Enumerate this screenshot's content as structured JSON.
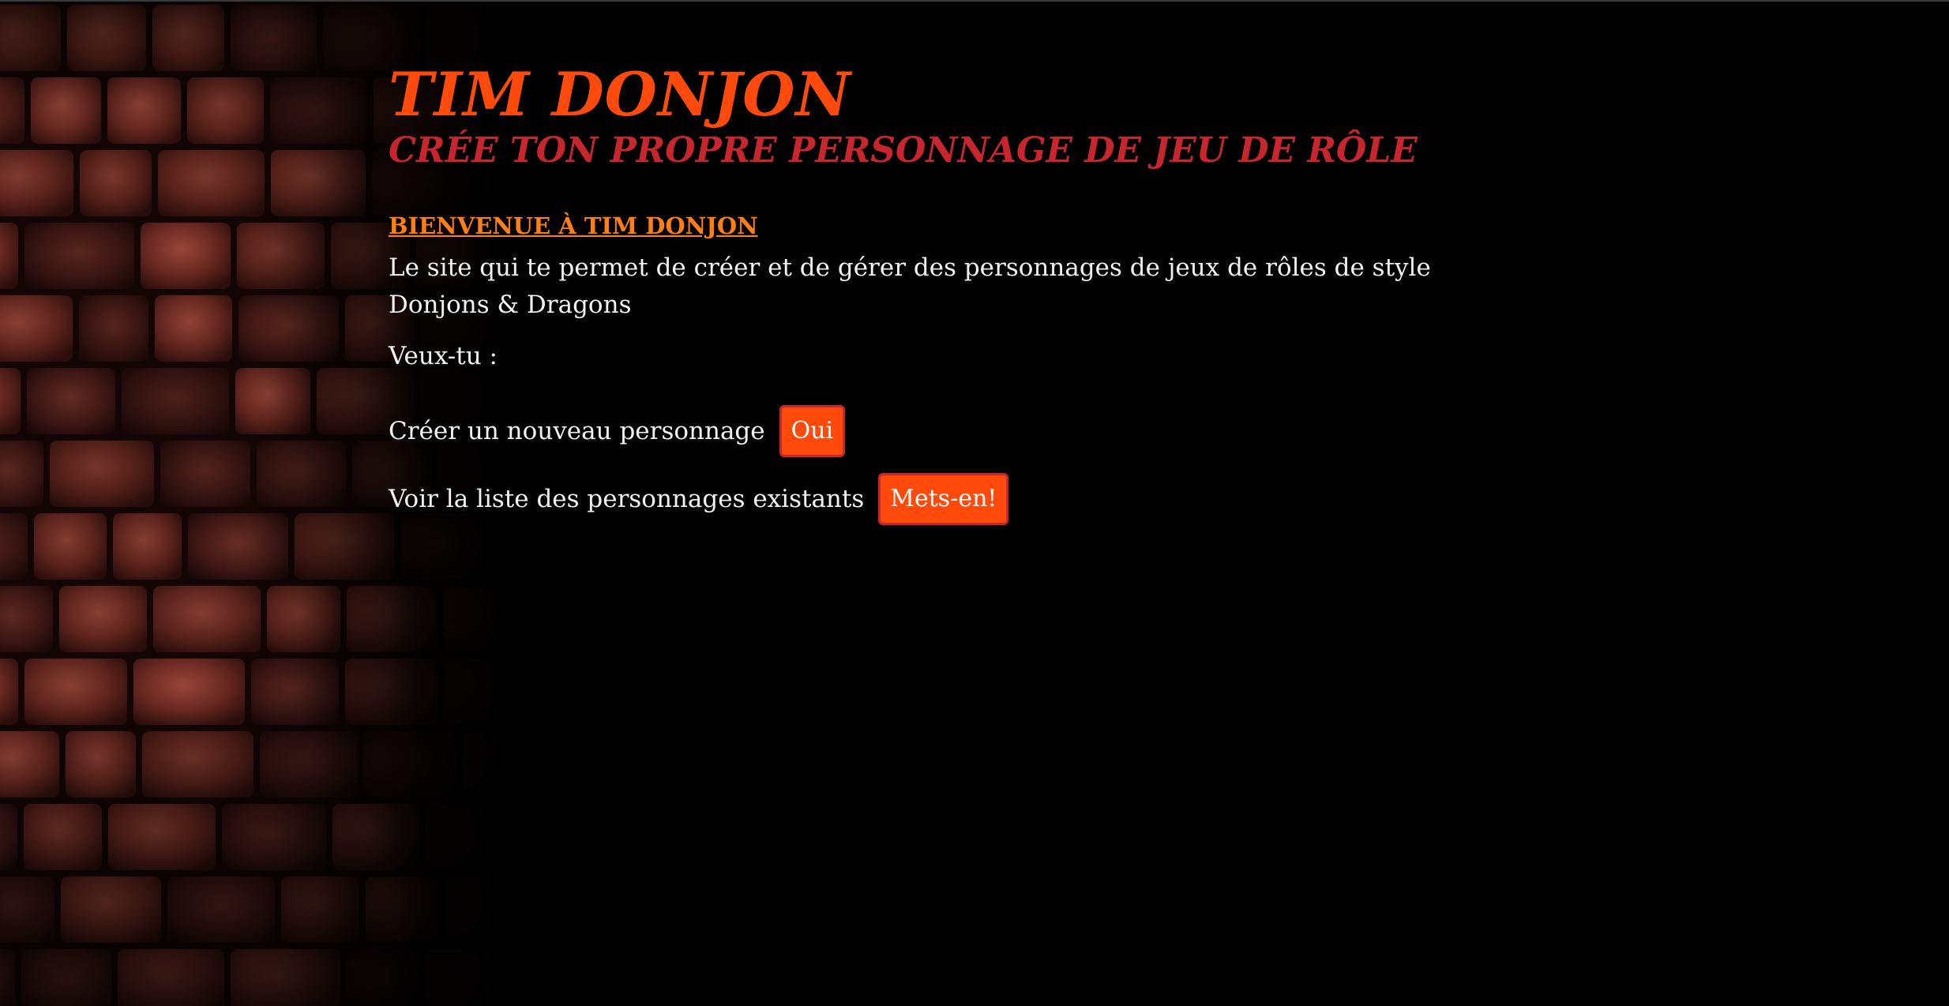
{
  "header": {
    "title": "TIM DONJON",
    "subtitle": "CRÉE TON PROPRE PERSONNAGE DE JEU DE RÔLE"
  },
  "main": {
    "welcome_heading": "BIENVENUE À TIM DONJON",
    "intro": "Le site qui te permet de créer et de gérer des personnages de jeux de rôles de style Donjons & Dragons",
    "prompt": "Veux-tu :",
    "actions": [
      {
        "label": "Créer un nouveau personnage",
        "button": "Oui"
      },
      {
        "label": "Voir la liste des personnages existants",
        "button": "Mets-en!"
      }
    ]
  },
  "colors": {
    "background": "#000000",
    "title": "#ff4a0c",
    "subtitle": "#c8262c",
    "heading": "#ff7f12",
    "button_bg": "#ff4a0c",
    "button_border": "#c8262c",
    "text": "#f2f2f2"
  }
}
